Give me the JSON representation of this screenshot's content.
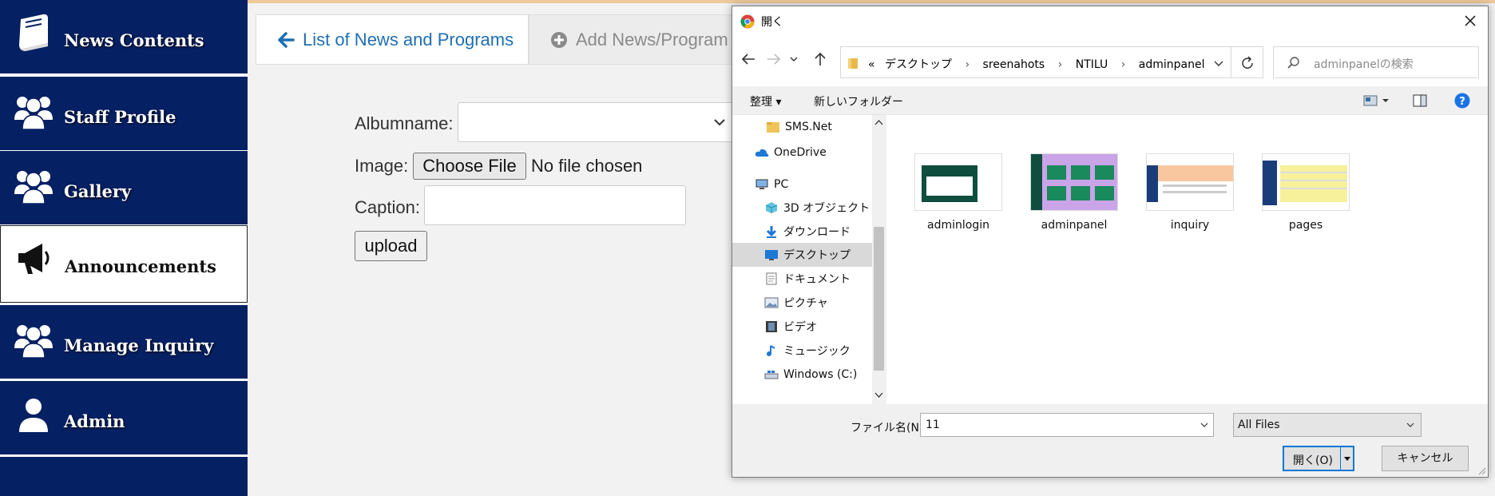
{
  "colors": {
    "sidebar_bg": "#052063",
    "tab_accent": "#1f6fb2",
    "dialog_primary": "#0078d7"
  },
  "sidebar": {
    "items": [
      {
        "label": "News Contents",
        "icon": "book-icon"
      },
      {
        "label": "Staff Profile",
        "icon": "users-icon"
      },
      {
        "label": "Gallery",
        "icon": "users-icon"
      },
      {
        "label": "Announcements",
        "icon": "megaphone-icon",
        "active": true
      },
      {
        "label": "Manage Inquiry",
        "icon": "users-icon"
      },
      {
        "label": "Admin",
        "icon": "user-icon"
      }
    ]
  },
  "tabs": [
    {
      "label": "List of News and Programs",
      "icon": "arrow-left-icon",
      "active": true
    },
    {
      "label": "Add News/Program",
      "icon": "plus-circle-icon",
      "active": false
    }
  ],
  "form": {
    "albumname_label": "Albumname:",
    "albumname_value": "",
    "image_label": "Image:",
    "choose_file_label": "Choose File",
    "no_file_text": "No file chosen",
    "caption_label": "Caption:",
    "caption_value": "",
    "upload_label": "upload"
  },
  "dialog": {
    "title": "開く",
    "breadcrumb": [
      "«",
      "デスクトップ",
      "sreenahots",
      "NTILU",
      "adminpanel"
    ],
    "search_placeholder": "adminpanelの検索",
    "toolbar": {
      "organize": "整理 ▾",
      "new_folder": "新しいフォルダー"
    },
    "tree": [
      {
        "label": "SMS.Net",
        "icon": "folder-icon"
      },
      {
        "label": "OneDrive",
        "icon": "cloud-icon"
      },
      {
        "label": "PC",
        "icon": "pc-icon"
      },
      {
        "label": "3D オブジェクト",
        "icon": "cube-icon"
      },
      {
        "label": "ダウンロード",
        "icon": "download-icon"
      },
      {
        "label": "デスクトップ",
        "icon": "desktop-icon",
        "selected": true
      },
      {
        "label": "ドキュメント",
        "icon": "document-icon"
      },
      {
        "label": "ピクチャ",
        "icon": "picture-icon"
      },
      {
        "label": "ビデオ",
        "icon": "video-icon"
      },
      {
        "label": "ミュージック",
        "icon": "music-icon"
      },
      {
        "label": "Windows (C:)",
        "icon": "drive-icon"
      }
    ],
    "files": [
      {
        "name": "adminlogin"
      },
      {
        "name": "adminpanel"
      },
      {
        "name": "inquiry"
      },
      {
        "name": "pages"
      }
    ],
    "filename_label": "ファイル名(N):",
    "filename_value": "11",
    "filetype_value": "All Files",
    "open_label": "開く(O)",
    "cancel_label": "キャンセル"
  }
}
